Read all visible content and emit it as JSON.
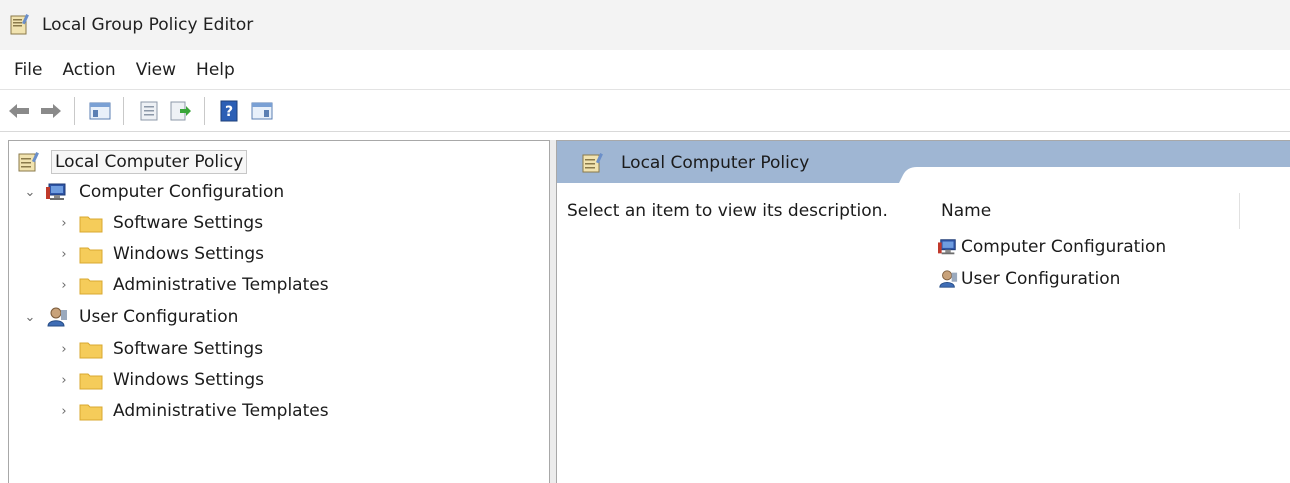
{
  "window": {
    "title": "Local Group Policy Editor",
    "icon": "policy-doc-icon"
  },
  "menu": [
    "File",
    "Action",
    "View",
    "Help"
  ],
  "toolbar": {
    "buttons": [
      "back-arrow-icon",
      "forward-arrow-icon",
      "show-hide-tree-icon",
      "properties-icon",
      "export-list-icon",
      "help-icon",
      "show-hide-action-pane-icon"
    ]
  },
  "tree": {
    "root": {
      "label": "Local Computer Policy",
      "icon": "policy-doc-icon"
    },
    "computer": {
      "label": "Computer Configuration",
      "icon": "computer-icon",
      "children": [
        "Software Settings",
        "Windows Settings",
        "Administrative Templates"
      ]
    },
    "user": {
      "label": "User Configuration",
      "icon": "user-icon",
      "children": [
        "Software Settings",
        "Windows Settings",
        "Administrative Templates"
      ]
    }
  },
  "details": {
    "header_title": "Local Computer Policy",
    "description": "Select an item to view its description.",
    "column_name": "Name",
    "items": [
      {
        "label": "Computer Configuration",
        "icon": "computer-icon"
      },
      {
        "label": "User Configuration",
        "icon": "user-icon"
      }
    ]
  },
  "colors": {
    "header_band": "#9fb6d3",
    "folder": "#f5cc5a",
    "root_highlight": "#f7f7f7"
  }
}
